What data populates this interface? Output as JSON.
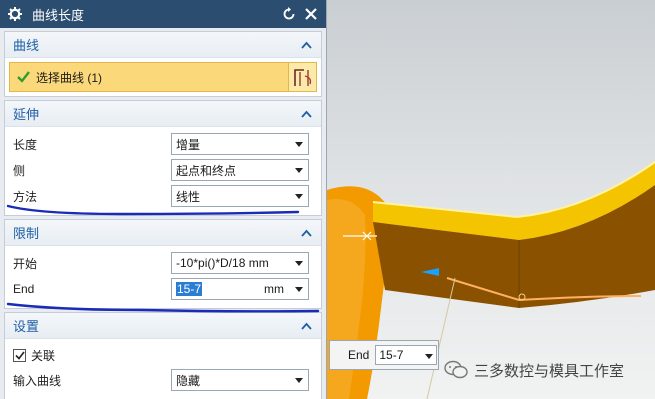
{
  "dialog": {
    "title": "曲线长度",
    "icons": {
      "settings": "gear-icon",
      "reset": "reset-icon",
      "close": "close-icon"
    }
  },
  "curve_section": {
    "header": "曲线",
    "select_label": "选择曲线 (1)",
    "colors": {
      "selected_bg": "#fbd97a"
    }
  },
  "extend_section": {
    "header": "延伸",
    "length_label": "长度",
    "length_value": "增量",
    "side_label": "侧",
    "side_value": "起点和终点",
    "method_label": "方法",
    "method_value": "线性"
  },
  "limits_section": {
    "header": "限制",
    "start_label": "开始",
    "start_value": "-10*pi()*D/18",
    "start_unit": "mm",
    "end_label": "End",
    "end_value": "15-7",
    "end_unit": "mm"
  },
  "settings_section": {
    "header": "设置",
    "associate_label": "关联",
    "associate_checked": true,
    "input_curve_label": "输入曲线",
    "input_curve_value": "隐藏"
  },
  "viewport_tooltip": {
    "label": "End",
    "value": "15-7"
  },
  "watermark": {
    "text": "三多数控与模具工作室"
  },
  "colors": {
    "titlebar": "#2b4d6f",
    "accent": "#1e5fa6",
    "model_top": "#f5c400",
    "model_side": "#8a5200",
    "model_body": "#f29a00",
    "annotation_line": "#1a2bb8"
  }
}
